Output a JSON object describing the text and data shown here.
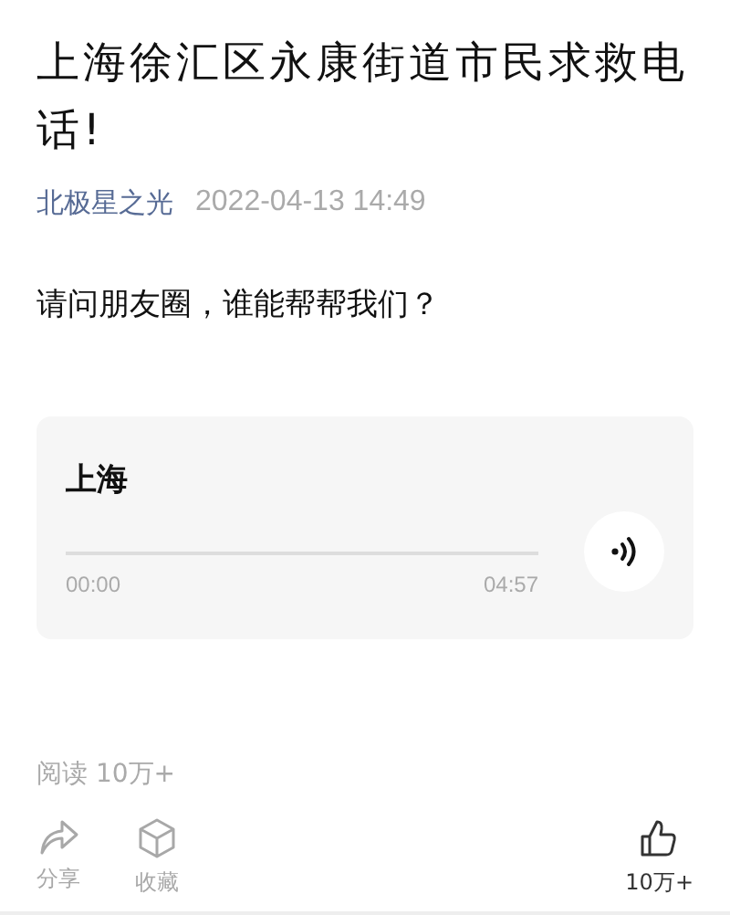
{
  "article": {
    "title": "上海徐汇区永康街道市民求救电话!",
    "author": "北极星之光",
    "date": "2022-04-13 14:49",
    "body": "请问朋友圈，谁能帮帮我们？"
  },
  "audio": {
    "title": "上海",
    "current_time": "00:00",
    "duration": "04:57"
  },
  "stats": {
    "reads": "阅读 10万+"
  },
  "actions": [
    {
      "kind": "share",
      "label": "分享",
      "disabled": true
    },
    {
      "kind": "collect",
      "label": "收藏",
      "disabled": true
    },
    {
      "kind": "like",
      "label": "10万+",
      "disabled": false
    }
  ]
}
